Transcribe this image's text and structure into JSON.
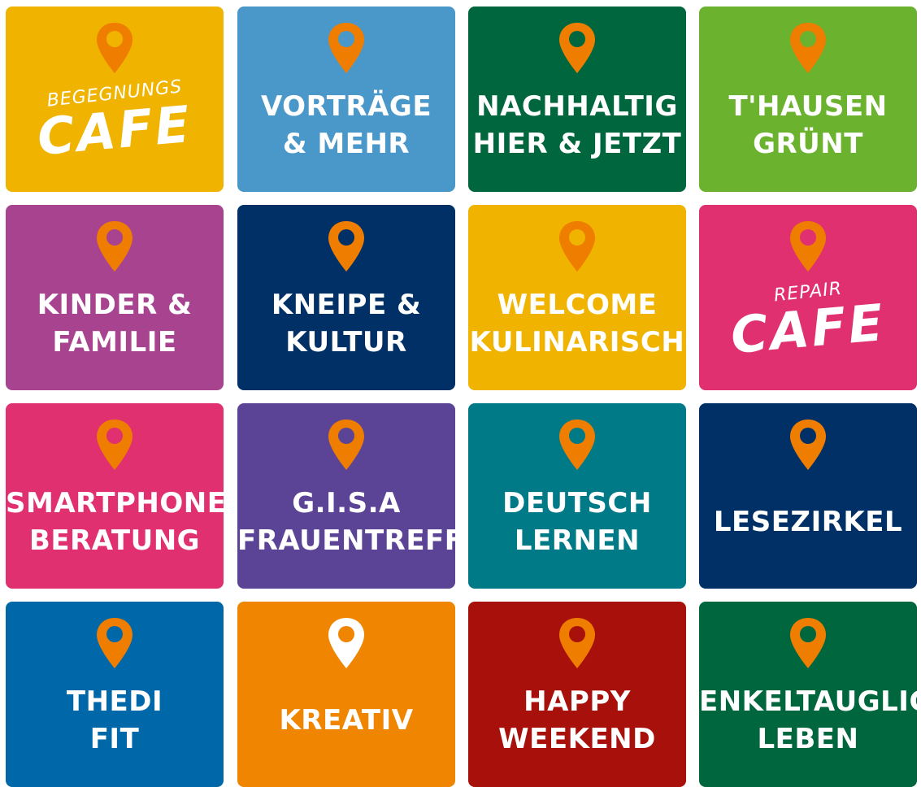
{
  "colors": {
    "pin": "#ef7d00",
    "pin_white": "#ffffff"
  },
  "tiles": [
    {
      "icon": "map-pin-icon",
      "pin": "orange",
      "color": "#f0b400",
      "logo_top": "BEGEGNUNGS",
      "logo_main": "CAFE"
    },
    {
      "icon": "map-pin-icon",
      "pin": "orange",
      "color": "#4a97c9",
      "line1": "VORTRÄGE",
      "line2": "& MEHR"
    },
    {
      "icon": "map-pin-icon",
      "pin": "orange",
      "color": "#00663d",
      "line1": "NACHHALTIG",
      "line2": "HIER & JETZT"
    },
    {
      "icon": "map-pin-icon",
      "pin": "orange",
      "color": "#6bb22e",
      "line1": "T'HAUSEN",
      "line2": "GRÜNT"
    },
    {
      "icon": "map-pin-icon",
      "pin": "orange",
      "color": "#a7438f",
      "line1": "KINDER &",
      "line2": "FAMILIE"
    },
    {
      "icon": "map-pin-icon",
      "pin": "orange",
      "color": "#003066",
      "line1": "KNEIPE &",
      "line2": "KULTUR"
    },
    {
      "icon": "map-pin-icon",
      "pin": "orange",
      "color": "#f0b400",
      "line1": "WELCOME",
      "line2": "KULINARISCH"
    },
    {
      "icon": "map-pin-icon",
      "pin": "orange",
      "color": "#e0306f",
      "logo_top": "REPAIR",
      "logo_main": "CAFE"
    },
    {
      "icon": "map-pin-icon",
      "pin": "orange",
      "color": "#e0306f",
      "line1": "SMARTPHONE",
      "line2": "BERATUNG"
    },
    {
      "icon": "map-pin-icon",
      "pin": "orange",
      "color": "#5b4496",
      "line1": "G.I.S.A",
      "line2": "FRAUENTREFF"
    },
    {
      "icon": "map-pin-icon",
      "pin": "orange",
      "color": "#007a87",
      "line1": "DEUTSCH",
      "line2": "LERNEN"
    },
    {
      "icon": "map-pin-icon",
      "pin": "orange",
      "color": "#003066",
      "line1": "LESEZIRKEL"
    },
    {
      "icon": "map-pin-icon",
      "pin": "orange",
      "color": "#0068a8",
      "line1": "THEDI",
      "line2": "FIT"
    },
    {
      "icon": "map-pin-icon",
      "pin": "white",
      "color": "#ef8500",
      "line1": "KREATIV"
    },
    {
      "icon": "map-pin-icon",
      "pin": "orange",
      "color": "#a8100c",
      "line1": "HAPPY",
      "line2": "WEEKEND"
    },
    {
      "icon": "map-pin-icon",
      "pin": "orange",
      "color": "#00663d",
      "line1": "ENKELTAUGLICH",
      "line2": "LEBEN"
    }
  ]
}
